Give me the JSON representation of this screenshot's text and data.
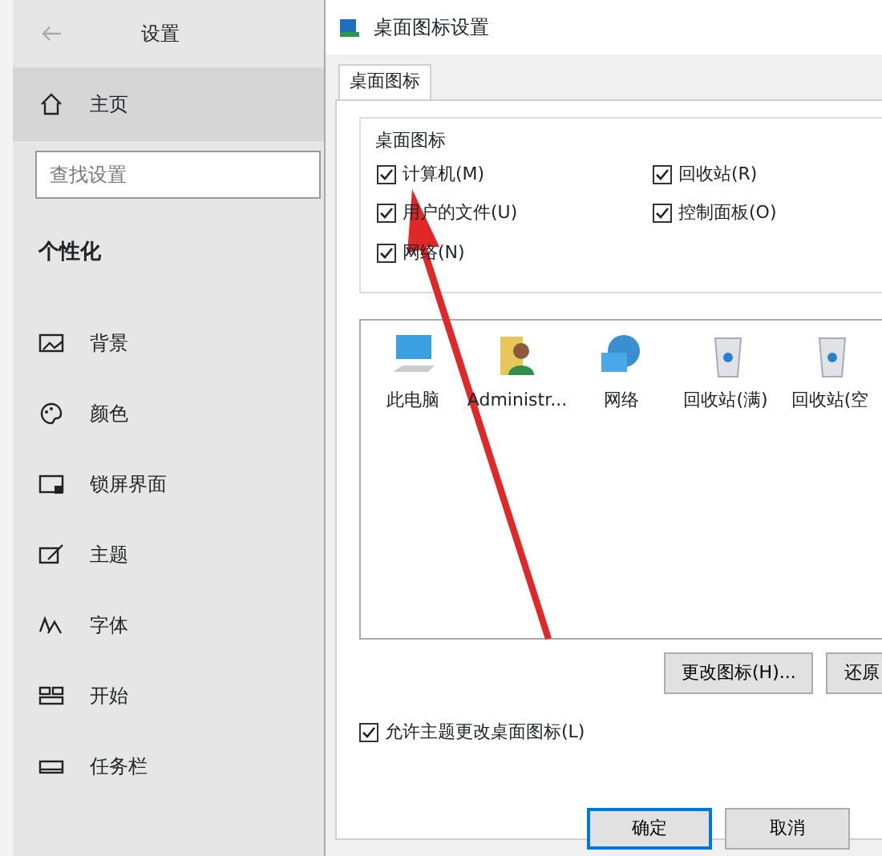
{
  "settings": {
    "title": "设置",
    "home": {
      "label": "主页",
      "highlighted": true
    },
    "search": {
      "placeholder": "查找设置"
    },
    "section": "个性化",
    "items": [
      {
        "label": "背景",
        "kind": "picture"
      },
      {
        "label": "颜色",
        "kind": "palette"
      },
      {
        "label": "锁屏界面",
        "kind": "lock"
      },
      {
        "label": "主题",
        "kind": "brush"
      },
      {
        "label": "字体",
        "kind": "font"
      },
      {
        "label": "开始",
        "kind": "start"
      },
      {
        "label": "任务栏",
        "kind": "taskbar"
      }
    ]
  },
  "dialog": {
    "title": "桌面图标设置",
    "tabs": [
      {
        "label": "桌面图标",
        "selected": true
      }
    ],
    "group_title": "桌面图标",
    "checkboxes": [
      {
        "label": "计算机(M)",
        "checked": true
      },
      {
        "label": "回收站(R)",
        "checked": true
      },
      {
        "label": "用户的文件(U)",
        "checked": true
      },
      {
        "label": "控制面板(O)",
        "checked": true
      },
      {
        "label": "网络(N)",
        "checked": true
      }
    ],
    "icons": [
      {
        "label": "此电脑",
        "kind": "monitor"
      },
      {
        "label": "Administr...",
        "kind": "user"
      },
      {
        "label": "网络",
        "kind": "network"
      },
      {
        "label": "回收站(满)",
        "kind": "bin"
      },
      {
        "label": "回收站(空",
        "kind": "bin"
      }
    ],
    "icon_buttons": [
      "更改图标(H)...",
      "还原"
    ],
    "allow_themes": {
      "label": "允许主题更改桌面图标(L)",
      "checked": true
    },
    "buttons": [
      {
        "label": "确定",
        "kind": "default"
      },
      {
        "label": "取消",
        "kind": "normal"
      }
    ]
  }
}
